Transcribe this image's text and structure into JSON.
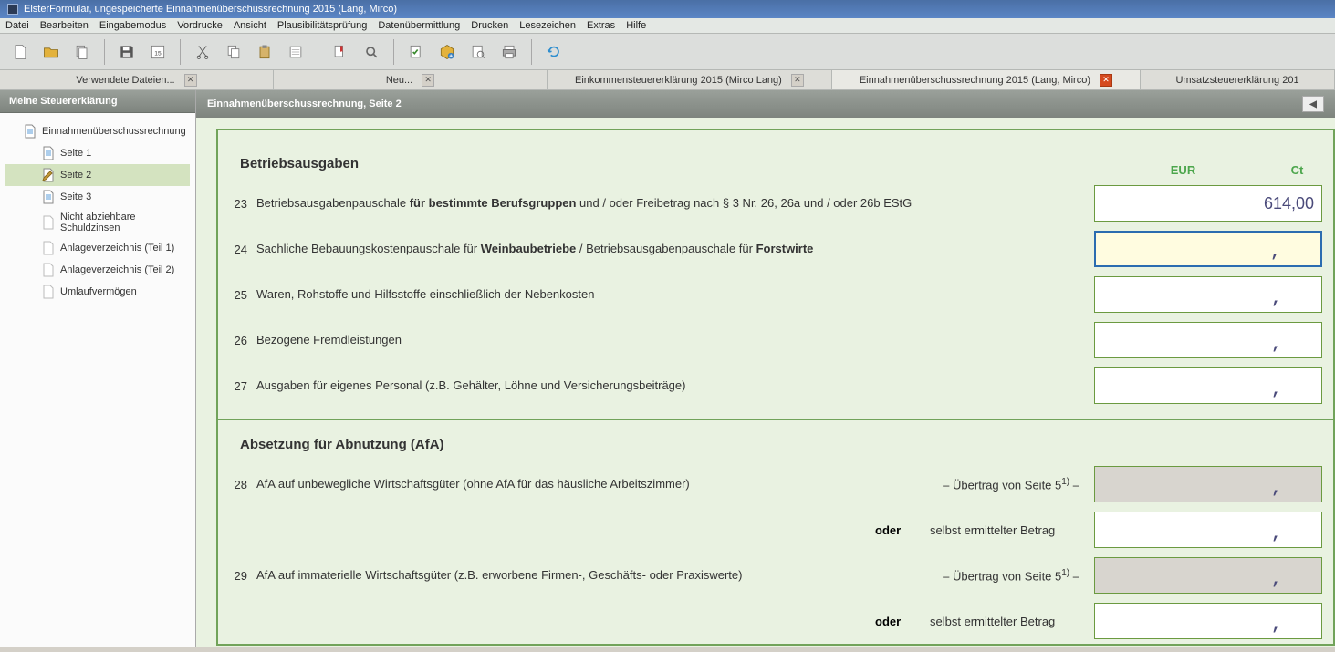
{
  "window": {
    "title": "ElsterFormular, ungespeicherte Einnahmenüberschussrechnung 2015 (Lang, Mirco)"
  },
  "menu": {
    "datei": "Datei",
    "bearbeiten": "Bearbeiten",
    "eingabemodus": "Eingabemodus",
    "vordrucke": "Vordrucke",
    "ansicht": "Ansicht",
    "plausibilitaet": "Plausibilitätsprüfung",
    "datenuebermittlung": "Datenübermittlung",
    "drucken": "Drucken",
    "lesezeichen": "Lesezeichen",
    "extras": "Extras",
    "hilfe": "Hilfe"
  },
  "tabs": {
    "verwendete": "Verwendete Dateien...",
    "neu": "Neu...",
    "einkommen": "Einkommensteuererklärung 2015 (Mirco Lang)",
    "einnahmen": "Einnahmenüberschussrechnung 2015 (Lang, Mirco)",
    "umsatz": "Umsatzsteuererklärung 201"
  },
  "sidebar": {
    "title": "Meine Steuererklärung",
    "root": "Einnahmenüberschussrechnung",
    "seite1": "Seite 1",
    "seite2": "Seite 2",
    "seite3": "Seite 3",
    "nichtabzieh": "Nicht abziehbare Schuldzinsen",
    "anlage1": "Anlageverzeichnis (Teil 1)",
    "anlage2": "Anlageverzeichnis (Teil 2)",
    "umlauf": "Umlaufvermögen"
  },
  "content": {
    "title": "Einnahmenüberschussrechnung, Seite 2",
    "eur": "EUR",
    "ct": "Ct",
    "section1": "Betriebsausgaben",
    "row23num": "23",
    "row23a": "Betriebsausgabenpauschale ",
    "row23b": "für bestimmte Berufsgruppen",
    "row23c": " und / oder Freibetrag nach § 3 Nr. 26, 26a und / oder 26b EStG",
    "row23val": "614,00",
    "row24num": "24",
    "row24a": "Sachliche Bebauungskostenpauschale für ",
    "row24b": "Weinbaubetriebe",
    "row24c": " / Betriebsausgabenpauschale für ",
    "row24d": "Forstwirte",
    "row25num": "25",
    "row25": "Waren, Rohstoffe und Hilfsstoffe einschließlich der Nebenkosten",
    "row26num": "26",
    "row26": "Bezogene Fremdleistungen",
    "row27num": "27",
    "row27": "Ausgaben für eigenes Personal (z.B. Gehälter, Löhne und Versicherungsbeiträge)",
    "section2": "Absetzung für Abnutzung (AfA)",
    "row28num": "28",
    "row28": "AfA auf unbewegliche Wirtschaftsgüter (ohne AfA für das häusliche Arbeitszimmer)",
    "row28hint_pre": "– Übertrag von Seite 5",
    "row28hint_sup": "1)",
    "row28hint_post": " –",
    "oder": "oder",
    "selbst": "selbst ermittelter Betrag",
    "row29num": "29",
    "row29": "AfA auf immaterielle Wirtschaftsgüter (z.B. erworbene Firmen-, Geschäfts- oder Praxiswerte)"
  }
}
